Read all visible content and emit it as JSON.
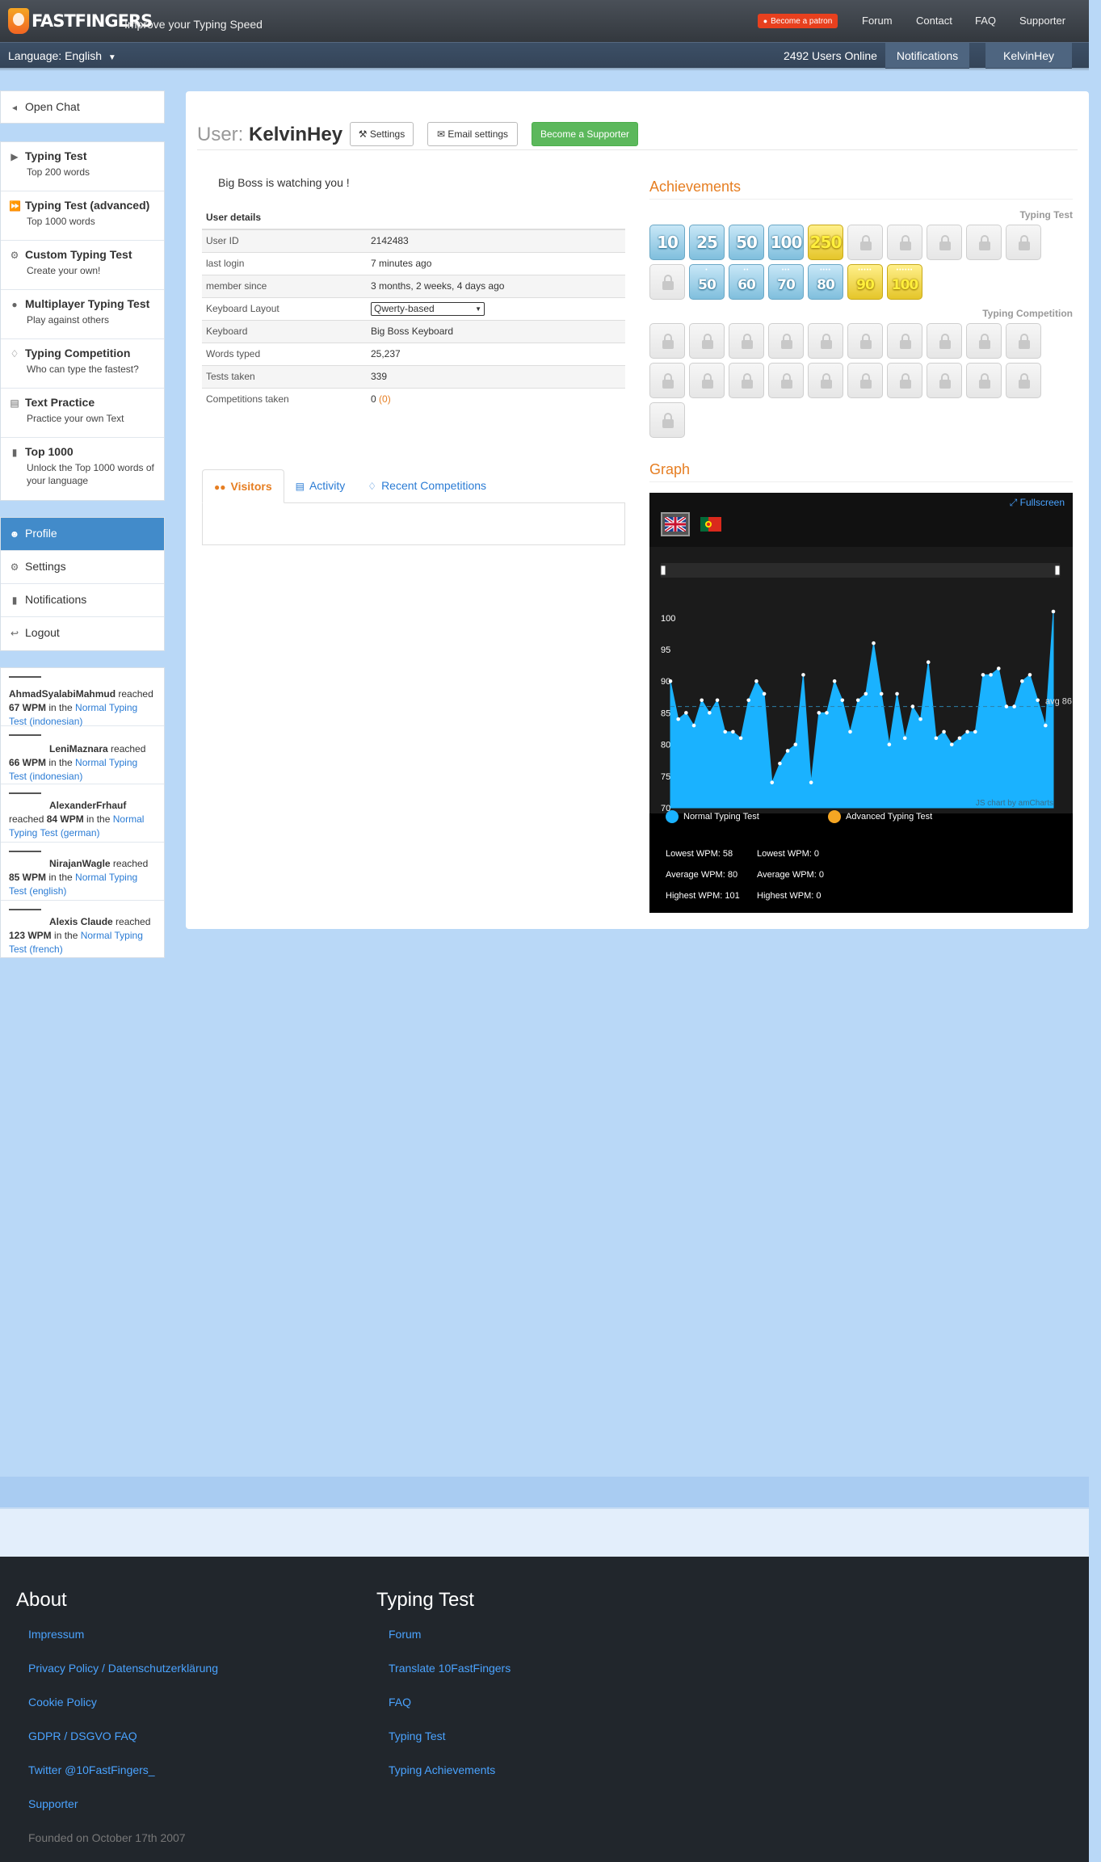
{
  "header": {
    "logo_text": "FASTFINGERS",
    "logo_prefix": "10",
    "tagline": "Improve your Typing Speed",
    "patron_label": "Become a patron",
    "nav": [
      "Forum",
      "Contact",
      "FAQ",
      "Supporter"
    ]
  },
  "subbar": {
    "language": "Language: English",
    "users_online": "2492 Users Online",
    "notifications": "Notifications",
    "username": "KelvinHey"
  },
  "sidebar": {
    "chat": "Open Chat",
    "menu": [
      {
        "title": "Typing Test",
        "sub": "Top 200 words",
        "icon": "play-icon"
      },
      {
        "title": "Typing Test (advanced)",
        "sub": "Top 1000 words",
        "icon": "fast-forward-icon"
      },
      {
        "title": "Custom Typing Test",
        "sub": "Create your own!",
        "icon": "gears-icon"
      },
      {
        "title": "Multiplayer Typing Test",
        "sub": "Play against others",
        "icon": "users-icon"
      },
      {
        "title": "Typing Competition",
        "sub": "Who can type the fastest?",
        "icon": "trophy-icon"
      },
      {
        "title": "Text Practice",
        "sub": "Practice your own Text",
        "icon": "file-icon"
      },
      {
        "title": "Top 1000",
        "sub": "Unlock the Top 1000 words of your language",
        "icon": "signal-icon"
      }
    ],
    "user_menu": [
      {
        "title": "Profile",
        "icon": "user-icon"
      },
      {
        "title": "Settings",
        "icon": "gear-icon"
      },
      {
        "title": "Notifications",
        "icon": "comment-icon"
      },
      {
        "title": "Logout",
        "icon": "sign-out-icon"
      }
    ],
    "activity": [
      {
        "name": "AhmadSyalabiMahmud",
        "pre": " reached ",
        "wpm": "67 WPM",
        "mid": " in the ",
        "test": "Normal Typing Test (indonesian)"
      },
      {
        "name": "LeniMaznara",
        "pre": " reached ",
        "wpm": "66 WPM",
        "mid": " in the ",
        "test": "Normal Typing Test (indonesian)"
      },
      {
        "name": "AlexanderFrhauf",
        "pre": " reached ",
        "wpm": "84 WPM",
        "mid": " in the ",
        "test": "Normal Typing Test (german)"
      },
      {
        "name": "NirajanWagle",
        "pre": " reached ",
        "wpm": "85 WPM",
        "mid": " in the ",
        "test": "Normal Typing Test (english)"
      },
      {
        "name": "Alexis Claude",
        "pre": " reached ",
        "wpm": "123 WPM",
        "mid": " in the ",
        "test": "Normal Typing Test (french)"
      }
    ]
  },
  "profile": {
    "title_prefix": "User:",
    "username": "KelvinHey",
    "settings_btn": "Settings",
    "email_btn": "Email settings",
    "supporter_btn": "Become a Supporter",
    "bigboss": "Big Boss is watching you !",
    "details_header": "User details",
    "details": [
      {
        "label": "User ID",
        "value": "2142483"
      },
      {
        "label": "last login",
        "value": "7 minutes ago"
      },
      {
        "label": "member since",
        "value": "3 months, 2 weeks, 4 days ago"
      },
      {
        "label": "Keyboard Layout",
        "value": "Qwerty-based"
      },
      {
        "label": "Keyboard",
        "value": "Big Boss Keyboard"
      },
      {
        "label": "Words typed",
        "value": "25,237"
      },
      {
        "label": "Tests taken",
        "value": "339"
      },
      {
        "label": "Competitions taken",
        "value": "0",
        "extra": "(0)"
      }
    ],
    "tabs": [
      "Visitors",
      "Activity",
      "Recent Competitions"
    ]
  },
  "achievements": {
    "title": "Achievements",
    "typing_test_label": "Typing Test",
    "competition_label": "Typing Competition",
    "typing_row1": [
      {
        "text": "10",
        "style": "blue"
      },
      {
        "text": "25",
        "style": "blue"
      },
      {
        "text": "50",
        "style": "blue"
      },
      {
        "text": "100",
        "style": "blue"
      },
      {
        "text": "250",
        "style": "yellow"
      },
      {
        "text": "",
        "style": "lock"
      },
      {
        "text": "",
        "style": "lock"
      },
      {
        "text": "",
        "style": "lock"
      },
      {
        "text": "",
        "style": "lock"
      },
      {
        "text": "",
        "style": "lock"
      }
    ],
    "typing_row2": [
      {
        "text": "",
        "style": "lock"
      },
      {
        "text": "50",
        "dots": "•",
        "style": "blue"
      },
      {
        "text": "60",
        "dots": "••",
        "style": "blue"
      },
      {
        "text": "70",
        "dots": "•••",
        "style": "blue"
      },
      {
        "text": "80",
        "dots": "••••",
        "style": "blue"
      },
      {
        "text": "90",
        "dots": "•••••",
        "style": "yellow"
      },
      {
        "text": "100",
        "dots": "••••••",
        "style": "yellow"
      }
    ],
    "competition_count": 21
  },
  "graph": {
    "title": "Graph",
    "fullscreen": "Fullscreen",
    "credit": "JS chart by amCharts",
    "avg_label": "avg 86",
    "legend": [
      {
        "name": "Normal Typing Test",
        "color": "#1ab2ff"
      },
      {
        "name": "Advanced Typing Test",
        "color": "#f5a623"
      }
    ],
    "stats_normal": [
      "Lowest WPM: 58",
      "Average WPM: 80",
      "Highest WPM: 101"
    ],
    "stats_advanced": [
      "Lowest WPM: 0",
      "Average WPM: 0",
      "Highest WPM: 0"
    ]
  },
  "chart_data": {
    "type": "area",
    "ylim": [
      70,
      101
    ],
    "y_ticks": [
      "70",
      "75",
      "80",
      "85",
      "90",
      "95",
      "100"
    ],
    "average": 86,
    "series": [
      {
        "name": "Normal Typing Test",
        "color": "#1ab2ff",
        "values": [
          90,
          84,
          85,
          83,
          87,
          85,
          87,
          82,
          82,
          81,
          87,
          90,
          88,
          74,
          77,
          79,
          80,
          91,
          74,
          85,
          85,
          90,
          87,
          82,
          87,
          88,
          96,
          88,
          80,
          88,
          81,
          86,
          84,
          93,
          81,
          82,
          80,
          81,
          82,
          82,
          91,
          91,
          92,
          86,
          86,
          90,
          91,
          87,
          83,
          101
        ]
      }
    ]
  },
  "footer": {
    "about_title": "About",
    "about_links": [
      "Impressum",
      "Privacy Policy / Datenschutzerklärung",
      "Cookie Policy",
      "GDPR / DSGVO FAQ",
      "Twitter @10FastFingers_",
      "Supporter"
    ],
    "typing_title": "Typing Test",
    "typing_links": [
      "Forum",
      "Translate 10FastFingers",
      "FAQ",
      "Typing Test",
      "Typing Achievements"
    ],
    "founded": "Founded on October 17th 2007"
  }
}
